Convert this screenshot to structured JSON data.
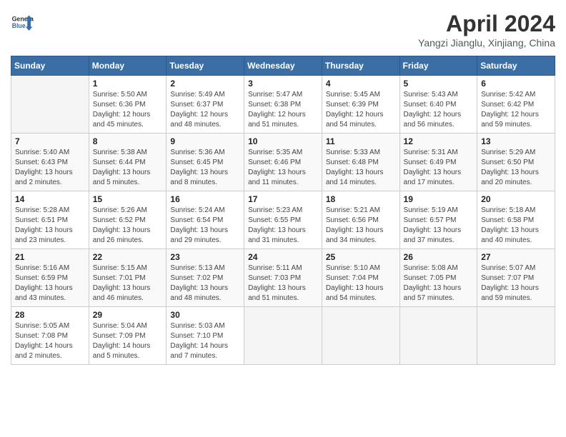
{
  "header": {
    "logo_line1": "General",
    "logo_line2": "Blue",
    "month": "April 2024",
    "location": "Yangzi Jianglu, Xinjiang, China"
  },
  "days_of_week": [
    "Sunday",
    "Monday",
    "Tuesday",
    "Wednesday",
    "Thursday",
    "Friday",
    "Saturday"
  ],
  "weeks": [
    [
      {
        "day": "",
        "info": ""
      },
      {
        "day": "1",
        "info": "Sunrise: 5:50 AM\nSunset: 6:36 PM\nDaylight: 12 hours\nand 45 minutes."
      },
      {
        "day": "2",
        "info": "Sunrise: 5:49 AM\nSunset: 6:37 PM\nDaylight: 12 hours\nand 48 minutes."
      },
      {
        "day": "3",
        "info": "Sunrise: 5:47 AM\nSunset: 6:38 PM\nDaylight: 12 hours\nand 51 minutes."
      },
      {
        "day": "4",
        "info": "Sunrise: 5:45 AM\nSunset: 6:39 PM\nDaylight: 12 hours\nand 54 minutes."
      },
      {
        "day": "5",
        "info": "Sunrise: 5:43 AM\nSunset: 6:40 PM\nDaylight: 12 hours\nand 56 minutes."
      },
      {
        "day": "6",
        "info": "Sunrise: 5:42 AM\nSunset: 6:42 PM\nDaylight: 12 hours\nand 59 minutes."
      }
    ],
    [
      {
        "day": "7",
        "info": "Sunrise: 5:40 AM\nSunset: 6:43 PM\nDaylight: 13 hours\nand 2 minutes."
      },
      {
        "day": "8",
        "info": "Sunrise: 5:38 AM\nSunset: 6:44 PM\nDaylight: 13 hours\nand 5 minutes."
      },
      {
        "day": "9",
        "info": "Sunrise: 5:36 AM\nSunset: 6:45 PM\nDaylight: 13 hours\nand 8 minutes."
      },
      {
        "day": "10",
        "info": "Sunrise: 5:35 AM\nSunset: 6:46 PM\nDaylight: 13 hours\nand 11 minutes."
      },
      {
        "day": "11",
        "info": "Sunrise: 5:33 AM\nSunset: 6:48 PM\nDaylight: 13 hours\nand 14 minutes."
      },
      {
        "day": "12",
        "info": "Sunrise: 5:31 AM\nSunset: 6:49 PM\nDaylight: 13 hours\nand 17 minutes."
      },
      {
        "day": "13",
        "info": "Sunrise: 5:29 AM\nSunset: 6:50 PM\nDaylight: 13 hours\nand 20 minutes."
      }
    ],
    [
      {
        "day": "14",
        "info": "Sunrise: 5:28 AM\nSunset: 6:51 PM\nDaylight: 13 hours\nand 23 minutes."
      },
      {
        "day": "15",
        "info": "Sunrise: 5:26 AM\nSunset: 6:52 PM\nDaylight: 13 hours\nand 26 minutes."
      },
      {
        "day": "16",
        "info": "Sunrise: 5:24 AM\nSunset: 6:54 PM\nDaylight: 13 hours\nand 29 minutes."
      },
      {
        "day": "17",
        "info": "Sunrise: 5:23 AM\nSunset: 6:55 PM\nDaylight: 13 hours\nand 31 minutes."
      },
      {
        "day": "18",
        "info": "Sunrise: 5:21 AM\nSunset: 6:56 PM\nDaylight: 13 hours\nand 34 minutes."
      },
      {
        "day": "19",
        "info": "Sunrise: 5:19 AM\nSunset: 6:57 PM\nDaylight: 13 hours\nand 37 minutes."
      },
      {
        "day": "20",
        "info": "Sunrise: 5:18 AM\nSunset: 6:58 PM\nDaylight: 13 hours\nand 40 minutes."
      }
    ],
    [
      {
        "day": "21",
        "info": "Sunrise: 5:16 AM\nSunset: 6:59 PM\nDaylight: 13 hours\nand 43 minutes."
      },
      {
        "day": "22",
        "info": "Sunrise: 5:15 AM\nSunset: 7:01 PM\nDaylight: 13 hours\nand 46 minutes."
      },
      {
        "day": "23",
        "info": "Sunrise: 5:13 AM\nSunset: 7:02 PM\nDaylight: 13 hours\nand 48 minutes."
      },
      {
        "day": "24",
        "info": "Sunrise: 5:11 AM\nSunset: 7:03 PM\nDaylight: 13 hours\nand 51 minutes."
      },
      {
        "day": "25",
        "info": "Sunrise: 5:10 AM\nSunset: 7:04 PM\nDaylight: 13 hours\nand 54 minutes."
      },
      {
        "day": "26",
        "info": "Sunrise: 5:08 AM\nSunset: 7:05 PM\nDaylight: 13 hours\nand 57 minutes."
      },
      {
        "day": "27",
        "info": "Sunrise: 5:07 AM\nSunset: 7:07 PM\nDaylight: 13 hours\nand 59 minutes."
      }
    ],
    [
      {
        "day": "28",
        "info": "Sunrise: 5:05 AM\nSunset: 7:08 PM\nDaylight: 14 hours\nand 2 minutes."
      },
      {
        "day": "29",
        "info": "Sunrise: 5:04 AM\nSunset: 7:09 PM\nDaylight: 14 hours\nand 5 minutes."
      },
      {
        "day": "30",
        "info": "Sunrise: 5:03 AM\nSunset: 7:10 PM\nDaylight: 14 hours\nand 7 minutes."
      },
      {
        "day": "",
        "info": ""
      },
      {
        "day": "",
        "info": ""
      },
      {
        "day": "",
        "info": ""
      },
      {
        "day": "",
        "info": ""
      }
    ]
  ]
}
